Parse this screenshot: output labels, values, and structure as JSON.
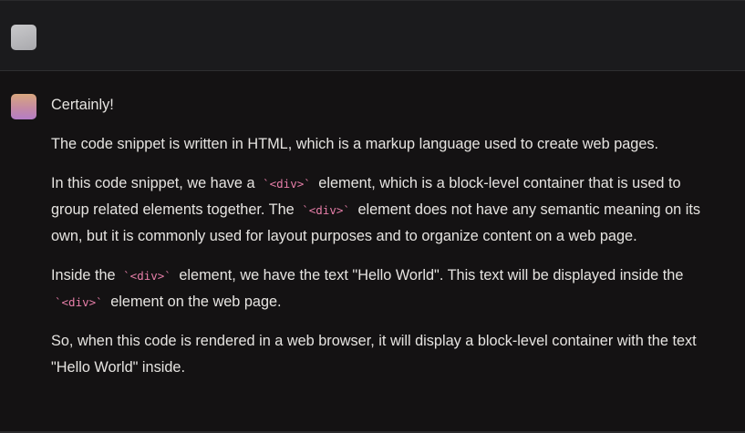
{
  "chat": {
    "user_message": {
      "avatar": "user-avatar"
    },
    "assistant_message": {
      "avatar": "assistant-avatar",
      "p1": "Certainly!",
      "p2": "The code snippet is written in HTML, which is a markup language used to create web pages.",
      "p3": {
        "t1": "In this code snippet, we have a ",
        "code1": "`<div>`",
        "t2": " element, which is a block-level container that is used to group related elements together. The ",
        "code2": "`<div>`",
        "t3": " element does not have any semantic meaning on its own, but it is commonly used for layout purposes and to organize content on a web page."
      },
      "p4": {
        "t1": "Inside the ",
        "code1": "`<div>`",
        "t2": " element, we have the text \"Hello World\". This text will be displayed inside the ",
        "code2": "`<div>`",
        "t3": " element on the web page."
      },
      "p5": "So, when this code is rendered in a web browser, it will display a block-level container with the text \"Hello World\" inside."
    }
  },
  "colors": {
    "background": "#141213",
    "user_row_background": "#1b1b1d",
    "text": "#e6e4e1",
    "inline_code": "#e67ea8"
  }
}
